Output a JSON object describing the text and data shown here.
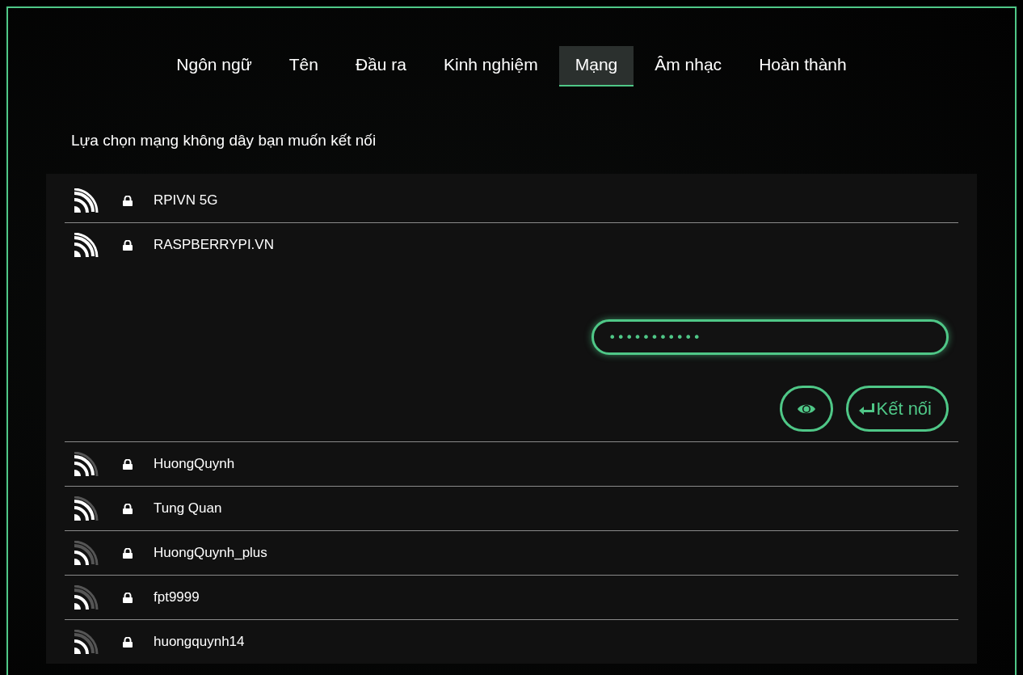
{
  "tabs": [
    {
      "label": "Ngôn ngữ",
      "selected": false
    },
    {
      "label": "Tên",
      "selected": false
    },
    {
      "label": "Đầu ra",
      "selected": false
    },
    {
      "label": "Kinh nghiệm",
      "selected": false
    },
    {
      "label": "Mạng",
      "selected": true
    },
    {
      "label": "Âm nhạc",
      "selected": false
    },
    {
      "label": "Hoàn thành",
      "selected": false
    }
  ],
  "prompt": "Lựa chọn mạng không dây bạn muốn kết nối",
  "networks": [
    {
      "name": "RPIVN 5G",
      "kind": "strong",
      "expanded": false
    },
    {
      "name": "RASPBERRYPI.VN",
      "kind": "strong",
      "expanded": true
    },
    {
      "name": "HuongQuynh",
      "kind": "good",
      "expanded": false
    },
    {
      "name": "Tung Quan",
      "kind": "good",
      "expanded": false
    },
    {
      "name": "HuongQuynh_plus",
      "kind": "fair",
      "expanded": false
    },
    {
      "name": "fpt9999",
      "kind": "fair",
      "expanded": false
    },
    {
      "name": "huongquynh14",
      "kind": "fair",
      "expanded": false
    }
  ],
  "password": {
    "value": "•••••••••••"
  },
  "connect_button": {
    "label": "Kết nối"
  }
}
